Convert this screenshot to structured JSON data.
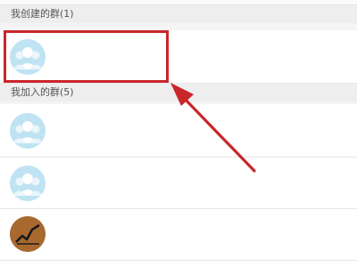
{
  "sections": {
    "created": {
      "header": "我创建的群(1)"
    },
    "joined": {
      "header": "我加入的群(5)"
    }
  },
  "groups": [
    {
      "name": ""
    },
    {
      "name": ""
    },
    {
      "name": ""
    },
    {
      "name": ""
    }
  ],
  "colors": {
    "highlight": "#c9262b",
    "arrow": "#c9262b",
    "avatar_bg": "#bfe3f2"
  },
  "icons": {
    "group_avatar": "group-people-icon",
    "chart_avatar": "stock-chart-icon"
  }
}
